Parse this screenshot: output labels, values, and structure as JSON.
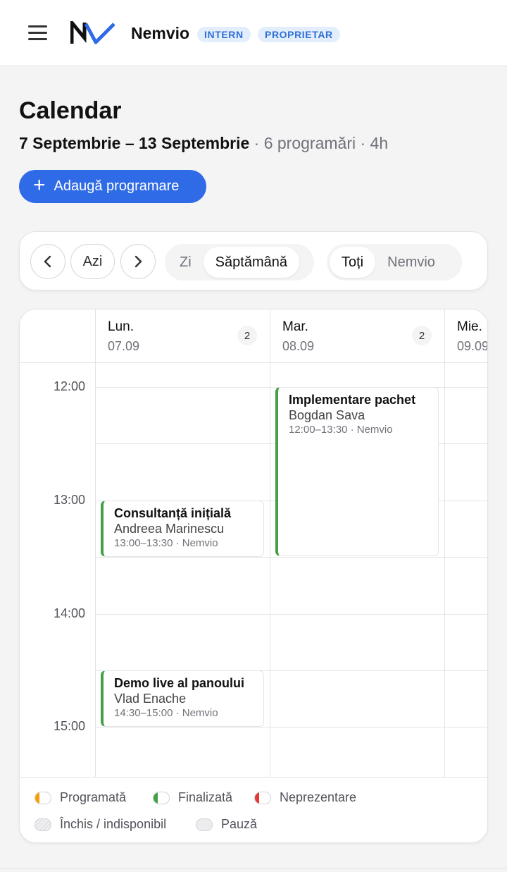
{
  "header": {
    "brand": "Nemvio",
    "badges": [
      "INTERN",
      "PROPRIETAR"
    ],
    "logo_text": "NV"
  },
  "page": {
    "title": "Calendar",
    "range": "7 Septembrie – 13 Septembrie",
    "appointments": " · 6 programări",
    "duration": " · 4h",
    "add_button": "Adaugă programare"
  },
  "toolbar": {
    "prev_icon": "chevron-left-icon",
    "today": "Azi",
    "next_icon": "chevron-right-icon",
    "view_modes": [
      "Zi",
      "Săptămână"
    ],
    "active_view": "Săptămână",
    "filters": [
      "Toți",
      "Nemvio"
    ],
    "active_filter": "Toți"
  },
  "calendar": {
    "days": [
      {
        "name": "Lun.",
        "date": "07.09",
        "count": "2"
      },
      {
        "name": "Mar.",
        "date": "08.09",
        "count": "2"
      },
      {
        "name": "Mie.",
        "date": "09.09",
        "count": ""
      }
    ],
    "hours": [
      "12:00",
      "13:00",
      "14:00",
      "15:00"
    ],
    "events": [
      {
        "title": "Implementare pachet",
        "client": "Bogdan Sava",
        "time": "12:00–13:30 · Nemvio",
        "status": "Finalizată"
      },
      {
        "title": "Consultanță inițială",
        "client": "Andreea Marinescu",
        "time": "13:00–13:30 · Nemvio",
        "status": "Finalizată"
      },
      {
        "title": "Demo live al panoului",
        "client": "Vlad Enache",
        "time": "14:30–15:00 · Nemvio",
        "status": "Finalizată"
      }
    ]
  },
  "legend": {
    "items": [
      {
        "label": "Programată",
        "color": "#f59e0b"
      },
      {
        "label": "Finalizată",
        "color": "#43a047"
      },
      {
        "label": "Neprezentare",
        "color": "#e53935"
      },
      {
        "label": "Închis / indisponibil",
        "color": ""
      },
      {
        "label": "Pauză",
        "color": ""
      }
    ]
  },
  "colors": {
    "accent": "#2f6be6",
    "badge_bg": "#e3eefc",
    "badge_text": "#2f6fd6",
    "finalized": "#43a047"
  }
}
